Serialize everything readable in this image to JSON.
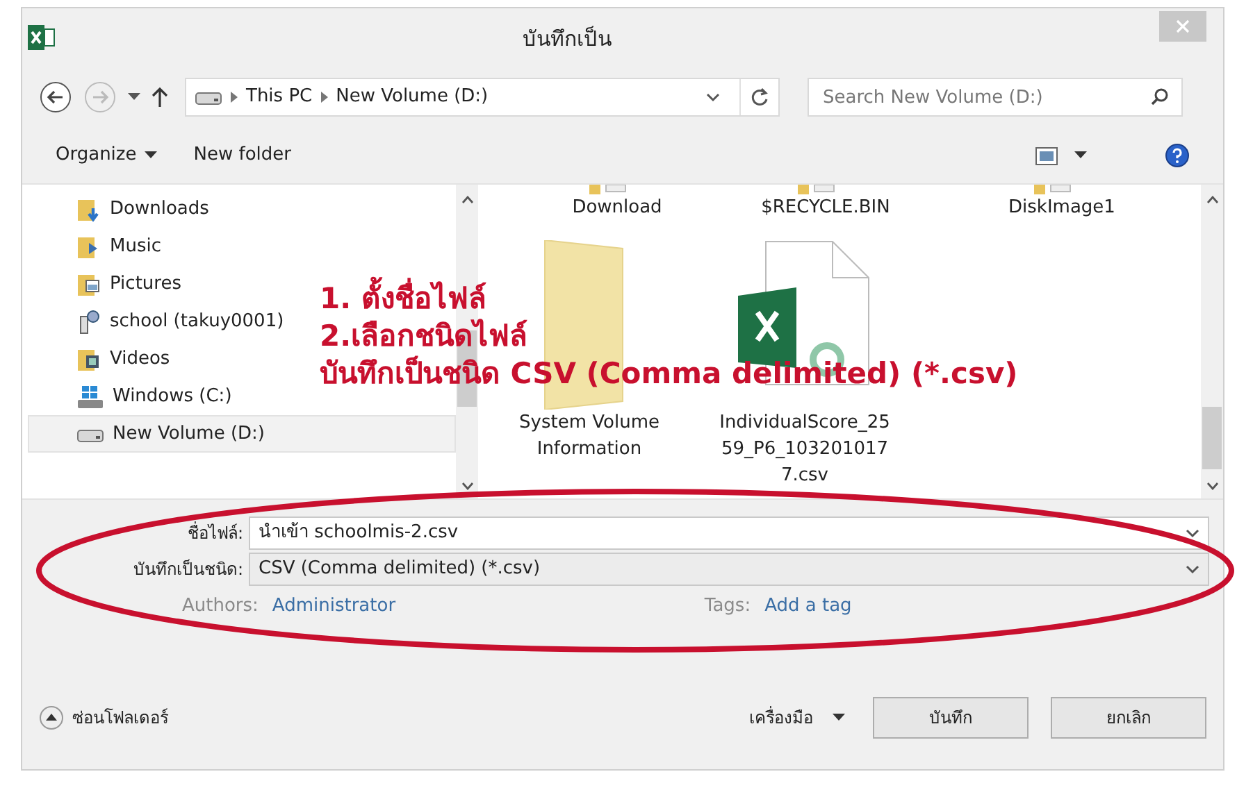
{
  "window": {
    "title": "บันทึกเป็น"
  },
  "address": {
    "path": [
      "This PC",
      "New Volume (D:)"
    ],
    "search_placeholder": "Search New Volume (D:)"
  },
  "toolbar": {
    "organize": "Organize",
    "new_folder": "New folder"
  },
  "nav": [
    {
      "label": "Downloads",
      "kind": "downloads",
      "selected": false
    },
    {
      "label": "Music",
      "kind": "music",
      "selected": false
    },
    {
      "label": "Pictures",
      "kind": "pictures",
      "selected": false
    },
    {
      "label": "school (takuy0001)",
      "kind": "network",
      "selected": false
    },
    {
      "label": "Videos",
      "kind": "videos",
      "selected": false
    },
    {
      "label": "Windows (C:)",
      "kind": "windows",
      "selected": false
    },
    {
      "label": "New Volume (D:)",
      "kind": "drive",
      "selected": true
    }
  ],
  "files_top": [
    "Download",
    "$RECYCLE.BIN",
    "DiskImage1"
  ],
  "files": [
    {
      "name": "System Volume Information",
      "kind": "folder"
    },
    {
      "name": "IndividualScore_2559_P6_1032010177.csv",
      "kind": "excel"
    }
  ],
  "annotation": [
    "1. ตั้งชื่อไฟล์",
    "2.เลือกชนิดไฟล์",
    "บันทึกเป็นชนิด CSV (Comma delimited) (*.csv)"
  ],
  "form": {
    "filename_label": "ชื่อไฟล์:",
    "filename": "นำเข้า schoolmis-2.csv",
    "type_label": "บันทึกเป็นชนิด:",
    "type": "CSV (Comma delimited) (*.csv)",
    "authors_label": "Authors:",
    "authors": "Administrator",
    "tags_label": "Tags:",
    "tags": "Add a tag"
  },
  "footer": {
    "hide_folders": "ซ่อนโฟลเดอร์",
    "tools": "เครื่องมือ",
    "save": "บันทึก",
    "cancel": "ยกเลิก"
  }
}
